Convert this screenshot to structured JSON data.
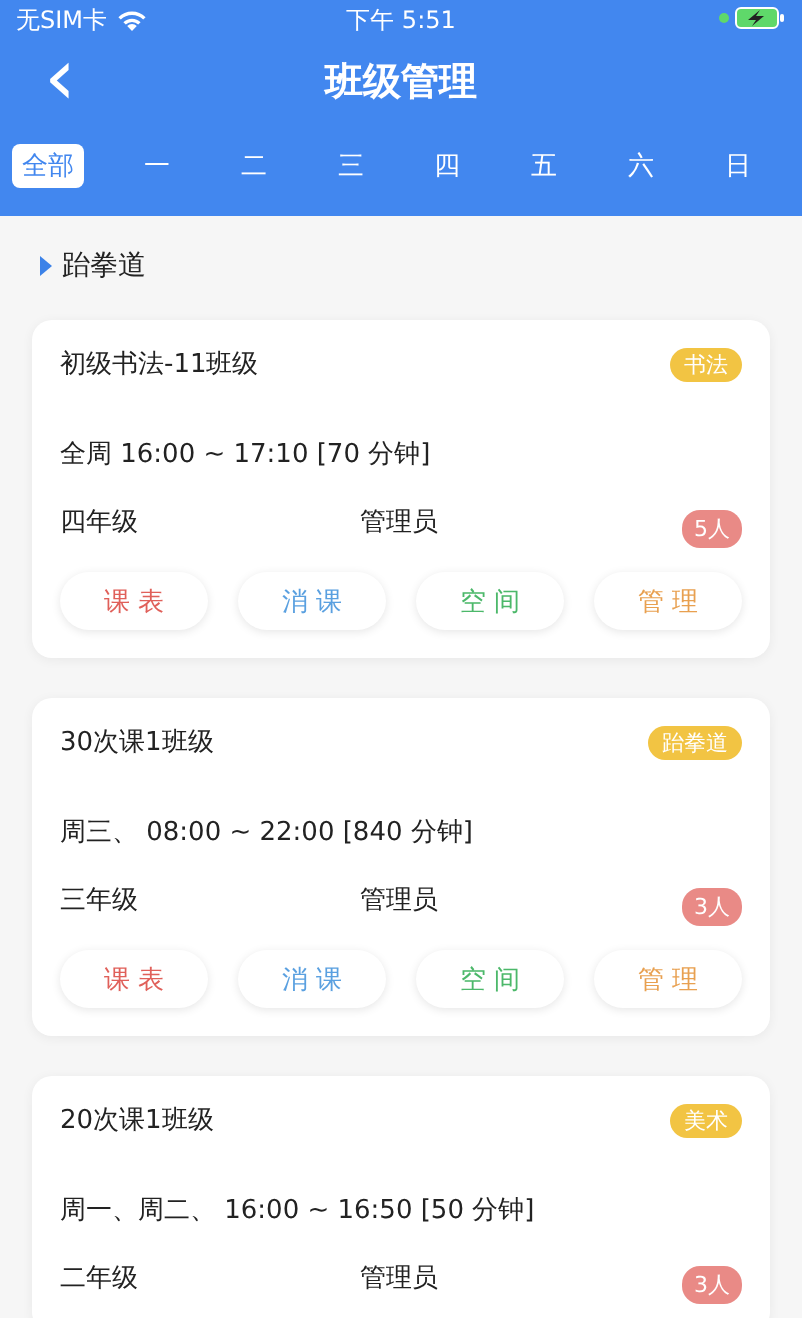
{
  "status_bar": {
    "carrier": "无SIM卡",
    "time": "下午 5:51"
  },
  "header": {
    "back": "‹",
    "title": "班级管理"
  },
  "day_tabs": [
    {
      "label": "全部",
      "selected": true
    },
    {
      "label": "一",
      "selected": false
    },
    {
      "label": "二",
      "selected": false
    },
    {
      "label": "三",
      "selected": false
    },
    {
      "label": "四",
      "selected": false
    },
    {
      "label": "五",
      "selected": false
    },
    {
      "label": "六",
      "selected": false
    },
    {
      "label": "日",
      "selected": false
    }
  ],
  "section": {
    "title": "跆拳道"
  },
  "classes": [
    {
      "name": "初级书法-11班级",
      "tag": "书法",
      "schedule": "全周 16:00 ~ 17:10 [70 分钟]",
      "grade": "四年级",
      "manager": "管理员",
      "count": "5人",
      "buttons": [
        {
          "label": "课 表",
          "color": "#e0605a"
        },
        {
          "label": "消 课",
          "color": "#5aa0e0"
        },
        {
          "label": "空 间",
          "color": "#4cb86a"
        },
        {
          "label": "管 理",
          "color": "#e8a050"
        }
      ]
    },
    {
      "name": "30次课1班级",
      "tag": "跆拳道",
      "schedule": "周三、 08:00 ~ 22:00 [840 分钟]",
      "grade": "三年级",
      "manager": "管理员",
      "count": "3人",
      "buttons": [
        {
          "label": "课 表",
          "color": "#e0605a"
        },
        {
          "label": "消 课",
          "color": "#5aa0e0"
        },
        {
          "label": "空 间",
          "color": "#4cb86a"
        },
        {
          "label": "管 理",
          "color": "#e8a050"
        }
      ]
    },
    {
      "name": "20次课1班级",
      "tag": "美术",
      "schedule": "周一、周二、 16:00 ~ 16:50 [50 分钟]",
      "grade": "二年级",
      "manager": "管理员",
      "count": "3人"
    }
  ]
}
